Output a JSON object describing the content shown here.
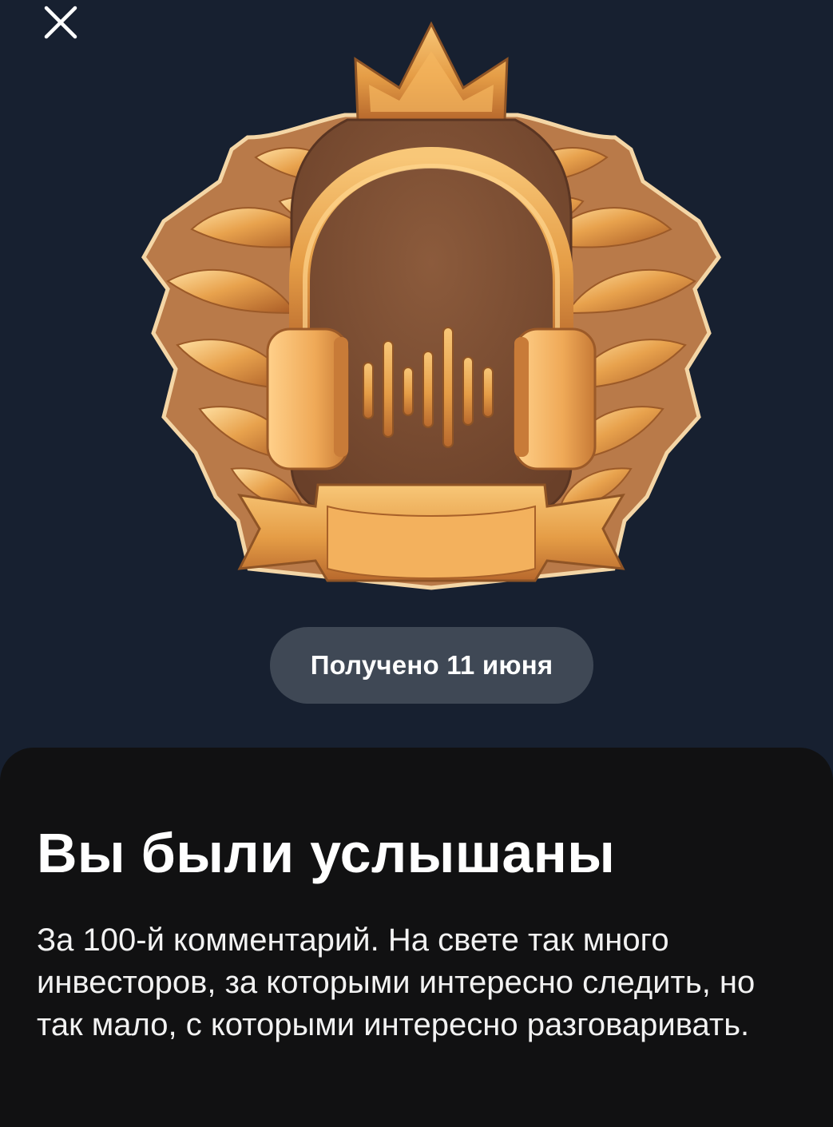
{
  "screen": {
    "close_icon": "close-icon",
    "badge": {
      "icon": "headphones-crest-icon",
      "colors": {
        "gold_light": "#F6C06A",
        "gold": "#E09A43",
        "gold_dark": "#A9612A",
        "shield": "#7C4F34"
      }
    },
    "received_label": "Получено 11 июня",
    "sheet": {
      "title": "Вы были услышаны",
      "description": "За 100-й комментарий. На свете так много инвесторов, за которыми интересно следить, но так мало, с которыми интересно разговаривать."
    }
  },
  "colors": {
    "background": "#172030",
    "pill": "#3F4855",
    "sheet": "#111112",
    "text": "#FFFFFF"
  }
}
